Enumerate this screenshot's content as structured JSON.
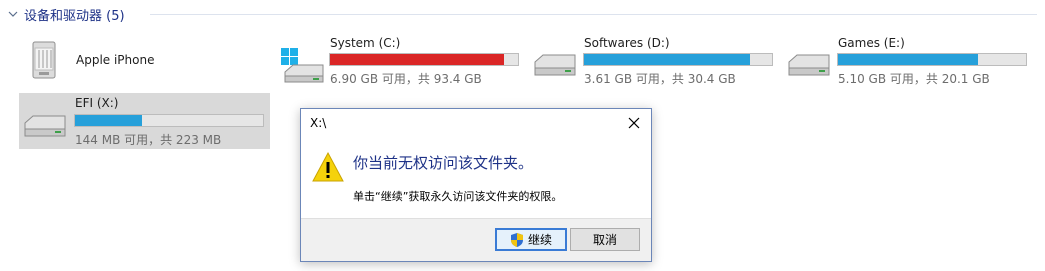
{
  "group": {
    "title": "设备和驱动器 (5)"
  },
  "devices": [
    {
      "name": "Apple iPhone"
    }
  ],
  "drives": [
    {
      "name": "System (C:)",
      "free_text": "6.90 GB 可用，共 93.4 GB",
      "used_fraction": 0.926,
      "fill_color": "#da2626"
    },
    {
      "name": "Softwares (D:)",
      "free_text": "3.61 GB 可用，共 30.4 GB",
      "used_fraction": 0.881,
      "fill_color": "#26a0da"
    },
    {
      "name": "Games (E:)",
      "free_text": "5.10 GB 可用，共 20.1 GB",
      "used_fraction": 0.746,
      "fill_color": "#26a0da"
    },
    {
      "name": "EFI (X:)",
      "free_text": "144 MB 可用，共 223 MB",
      "used_fraction": 0.354,
      "fill_color": "#26a0da"
    }
  ],
  "dialog": {
    "title": "X:\\",
    "message": "你当前无权访问该文件夹。",
    "detail": "单击“继续”获取永久访问该文件夹的权限。",
    "continue_label": "继续",
    "cancel_label": "取消"
  }
}
